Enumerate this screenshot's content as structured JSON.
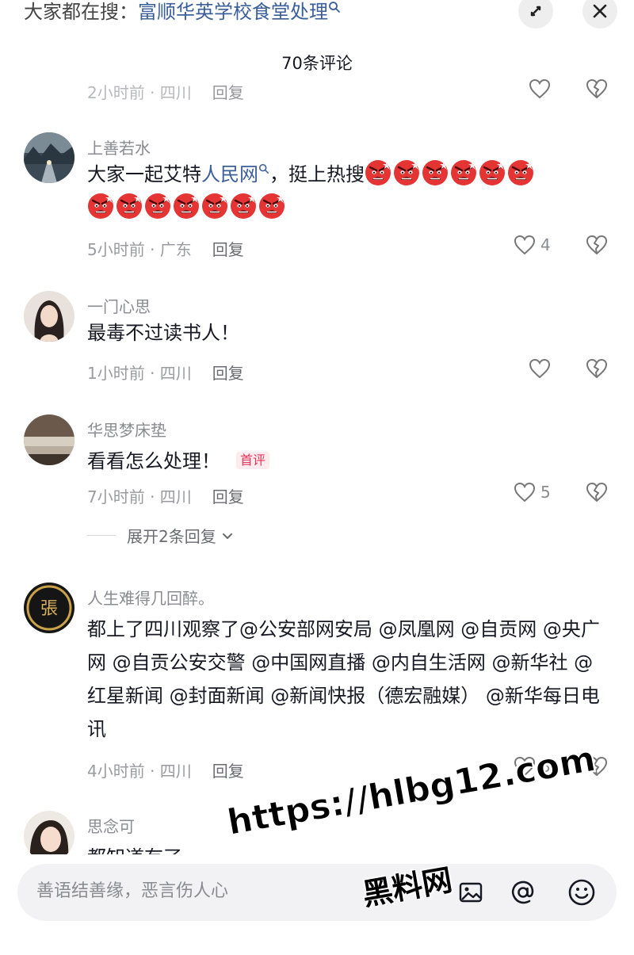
{
  "search_hint": {
    "prefix": "大家都在搜：",
    "term": "富顺华英学校食堂处理"
  },
  "header": {
    "comment_count": "70条评论"
  },
  "partial_top": {
    "meta": "2小时前 · 四川",
    "reply": "回复"
  },
  "comments": [
    {
      "username": "上善若水",
      "text_before": "大家一起艾特",
      "link": "人民网",
      "text_after": "，挺上热搜",
      "emoji": "angry-face",
      "emoji_count_line1": 6,
      "emoji_count_line2": 7,
      "meta": "5小时前 · 广东",
      "reply": "回复",
      "likes": "4"
    },
    {
      "username": "一门心思",
      "text": "最毒不过读书人！",
      "meta": "1小时前 · 四川",
      "reply": "回复",
      "likes": ""
    },
    {
      "username": "华思梦床垫",
      "text": "看看怎么处理！",
      "badge": "首评",
      "meta": "7小时前 · 四川",
      "reply": "回复",
      "likes": "5",
      "expand_replies": "展开2条回复"
    },
    {
      "username": "人生难得几回醉。",
      "text": "都上了四川观察了@公安部网安局 @凤凰网 @自贡网 @央广网 @自贡公安交警 @中国网直播 @内自生活网 @新华社 @红星新闻 @封面新闻 @新闻快报（德宏融媒） @新华每日电讯",
      "meta": "4小时前 · 四川",
      "reply": "回复",
      "likes": "3"
    },
    {
      "username": "思念可",
      "text": "都知道有了"
    }
  ],
  "input": {
    "placeholder": "善语结善缘，恶言伤人心"
  },
  "watermark": {
    "line1": "https://hlbg12.com",
    "line2": "黑料网"
  },
  "colors": {
    "link": "#3a5f9a",
    "badge": "#e8345a",
    "meta": "#9a9ba0"
  }
}
